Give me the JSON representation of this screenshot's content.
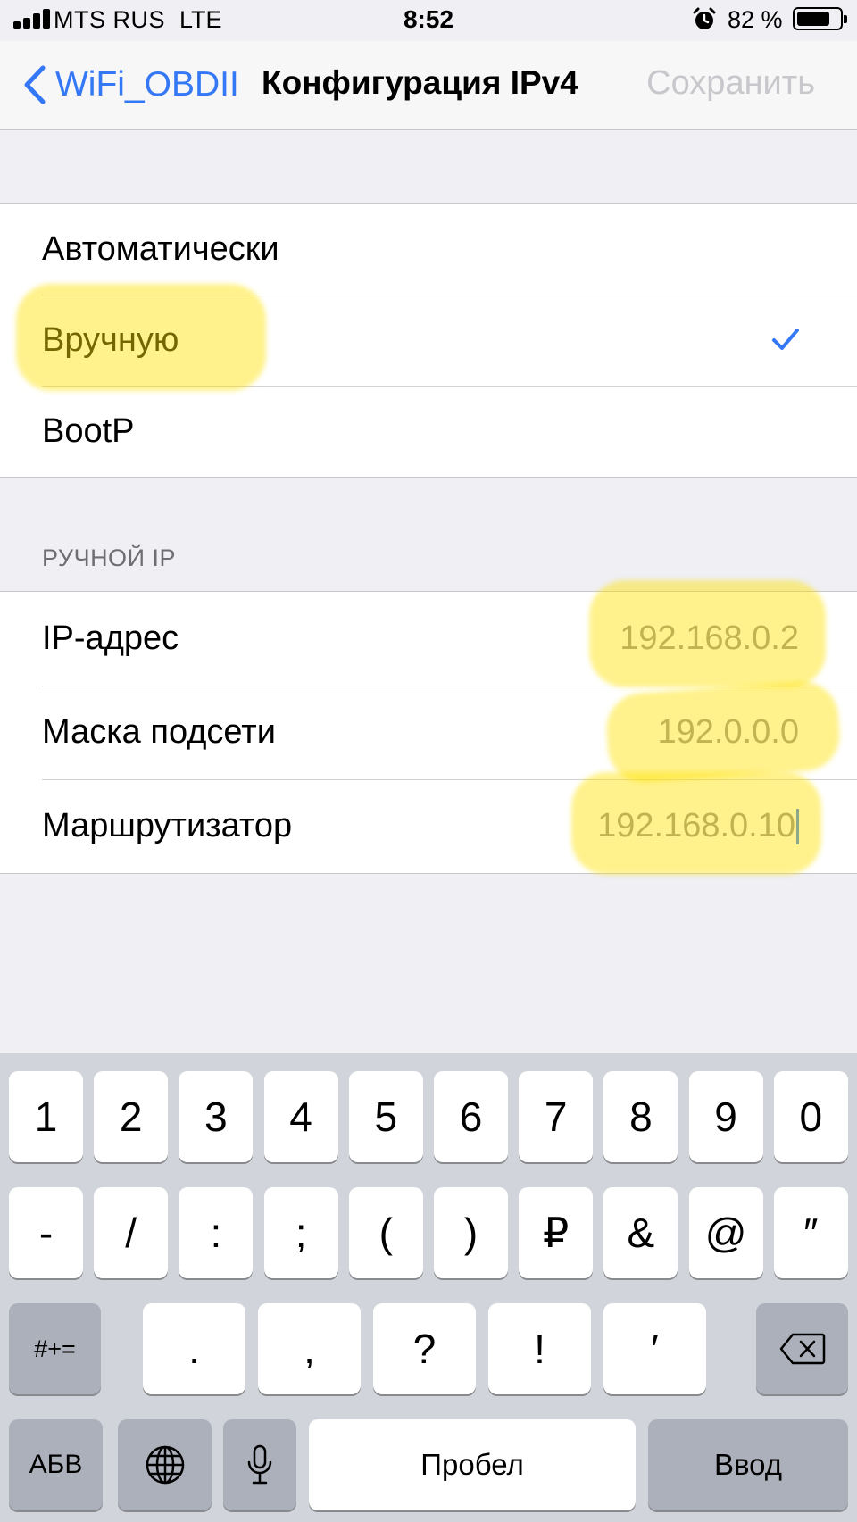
{
  "status_bar": {
    "carrier": "MTS RUS",
    "network": "LTE",
    "time": "8:52",
    "battery_text": "82 %",
    "battery_level": 0.82,
    "icons": [
      "signal-icon",
      "alarm-icon",
      "battery-icon"
    ]
  },
  "nav": {
    "back_label": "WiFi_OBDII",
    "title": "Конфигурация IPv4",
    "save_label": "Сохранить"
  },
  "config_options": [
    {
      "label": "Автоматически",
      "selected": false
    },
    {
      "label": "Вручную",
      "selected": true
    },
    {
      "label": "BootP",
      "selected": false
    }
  ],
  "manual_section": {
    "header": "РУЧНОЙ IP",
    "fields": [
      {
        "label": "IP-адрес",
        "value": "192.168.0.2"
      },
      {
        "label": "Маска подсети",
        "value": "192.0.0.0"
      },
      {
        "label": "Маршрутизатор",
        "value": "192.168.0.10"
      }
    ]
  },
  "highlight_color": "#ffe200",
  "accent_color": "#3478f6",
  "keyboard": {
    "row1": [
      "1",
      "2",
      "3",
      "4",
      "5",
      "6",
      "7",
      "8",
      "9",
      "0"
    ],
    "row2": [
      "-",
      "/",
      ":",
      ";",
      "(",
      ")",
      "₽",
      "&",
      "@",
      "″"
    ],
    "row3": {
      "shift": "#+=",
      "keys": [
        ".",
        ",",
        "?",
        "!",
        "′"
      ],
      "delete_icon": "backspace-icon"
    },
    "row4": {
      "abc": "АБВ",
      "globe_icon": "globe-icon",
      "mic_icon": "microphone-icon",
      "space": "Пробел",
      "return": "Ввод"
    }
  }
}
